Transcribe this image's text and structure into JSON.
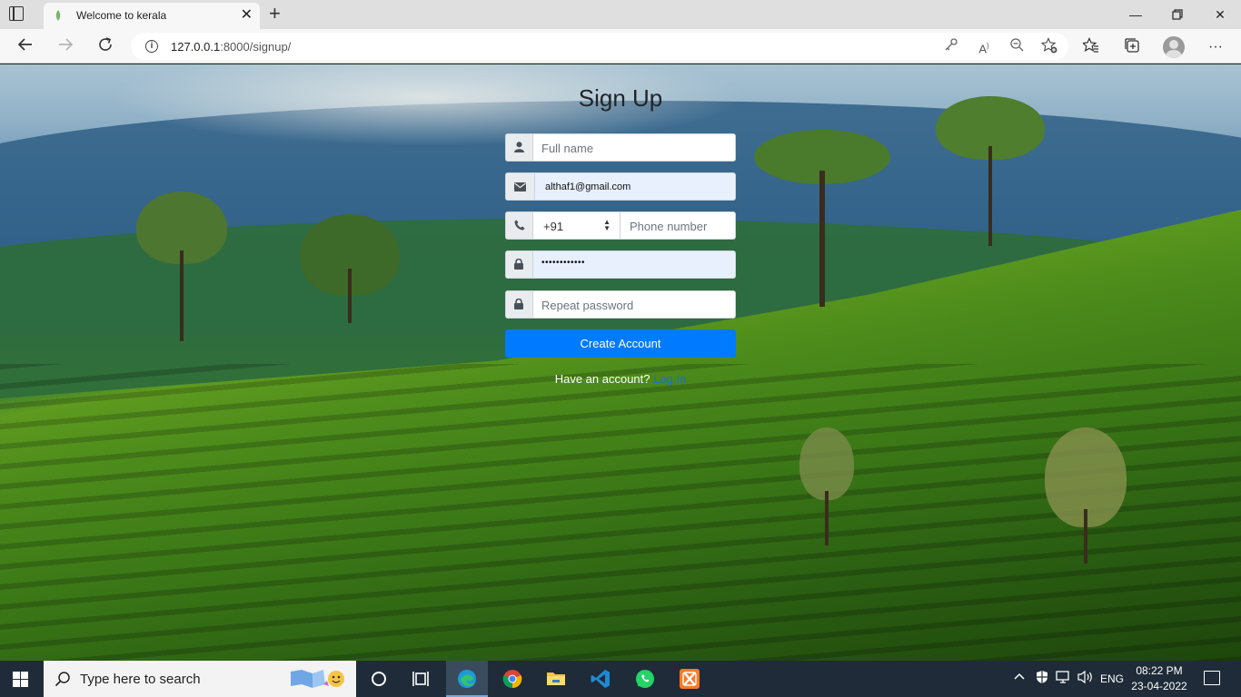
{
  "browser": {
    "tab_title": "Welcome to kerala",
    "url_host": "127.0.0.1",
    "url_path": ":8000/signup/",
    "icons": [
      "tab-actions-icon",
      "close-icon",
      "plus-icon",
      "minimize-icon",
      "maximize-icon",
      "back-icon",
      "forward-icon",
      "refresh-icon",
      "info-icon",
      "key-icon",
      "read-aloud-icon",
      "zoom-icon",
      "add-favorite-icon",
      "favorites-icon",
      "collections-icon",
      "profile-icon",
      "more-icon"
    ]
  },
  "form": {
    "title": "Sign Up",
    "full_name_placeholder": "Full name",
    "email_value": "althaf1@gmail.com",
    "country_code": "+91",
    "phone_placeholder": "Phone number",
    "password_value": "••••••••••••",
    "repeat_password_placeholder": "Repeat password",
    "submit_label": "Create Account",
    "have_account_text": "Have an account?",
    "login_link": "Log In"
  },
  "taskbar": {
    "search_placeholder": "Type here to search",
    "language": "ENG",
    "time": "08:22 PM",
    "date": "23-04-2022"
  },
  "colors": {
    "accent": "#007bff",
    "link": "#1e6fd0",
    "taskbar": "#1f2b38"
  }
}
